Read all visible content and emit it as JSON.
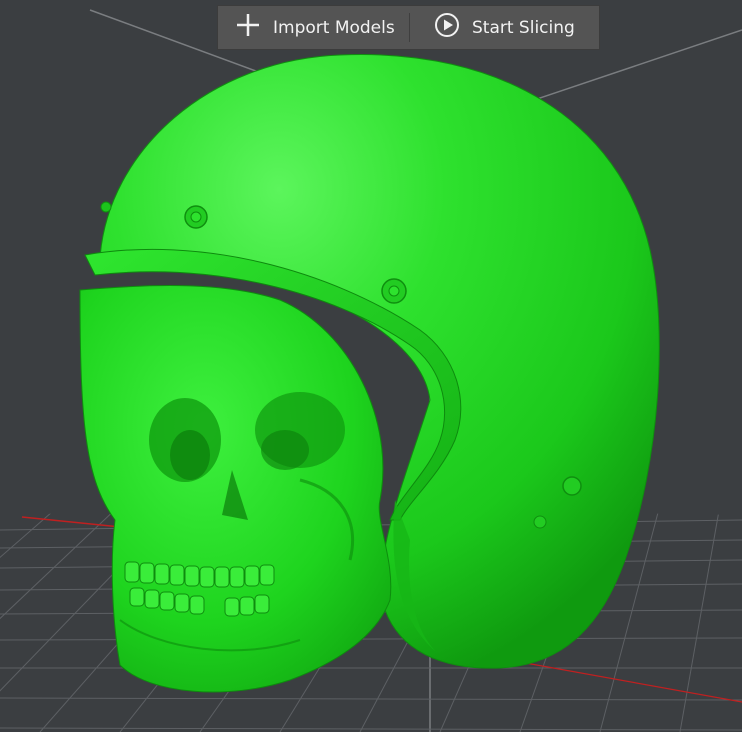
{
  "toolbar": {
    "import_label": "Import Models",
    "import_icon": "plus-icon",
    "start_label": "Start Slicing",
    "start_icon": "play-circle-icon"
  },
  "viewport": {
    "background_color": "#3b3e41",
    "grid_color": "#5d6064",
    "model_color": "#22d822",
    "model_description": "helmet-with-skull"
  }
}
